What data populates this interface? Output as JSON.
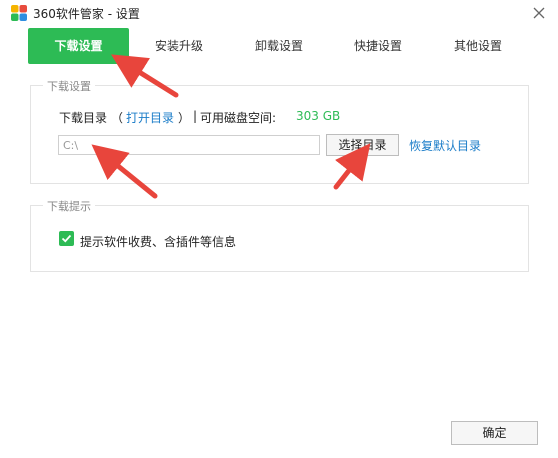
{
  "window": {
    "title": "360软件管家 - 设置",
    "close_glyph": "✕"
  },
  "tabs": [
    {
      "label": "下载设置",
      "active": true
    },
    {
      "label": "安装升级",
      "active": false
    },
    {
      "label": "卸载设置",
      "active": false
    },
    {
      "label": "快捷设置",
      "active": false
    },
    {
      "label": "其他设置",
      "active": false
    }
  ],
  "download_group": {
    "legend": "下载设置",
    "dir_label": "下载目录",
    "paren_open": "（",
    "open_dir_link": "打开目录",
    "paren_close": "）",
    "separator": "|",
    "space_label": "可用磁盘空间:",
    "space_value": "303 GB",
    "path_value": "C:\\",
    "choose_button": "选择目录",
    "restore_link": "恢复默认目录"
  },
  "hint_group": {
    "legend": "下载提示",
    "checkbox_checked": true,
    "checkbox_label": "提示软件收费、含插件等信息"
  },
  "footer": {
    "ok_button": "确定"
  },
  "colors": {
    "accent": "#2dbb55",
    "link": "#1a7cc8",
    "annotation_arrow": "#e8453c"
  },
  "icons": {
    "app": "360-pinwheel-icon",
    "close": "close-icon",
    "check": "checkmark-icon"
  }
}
